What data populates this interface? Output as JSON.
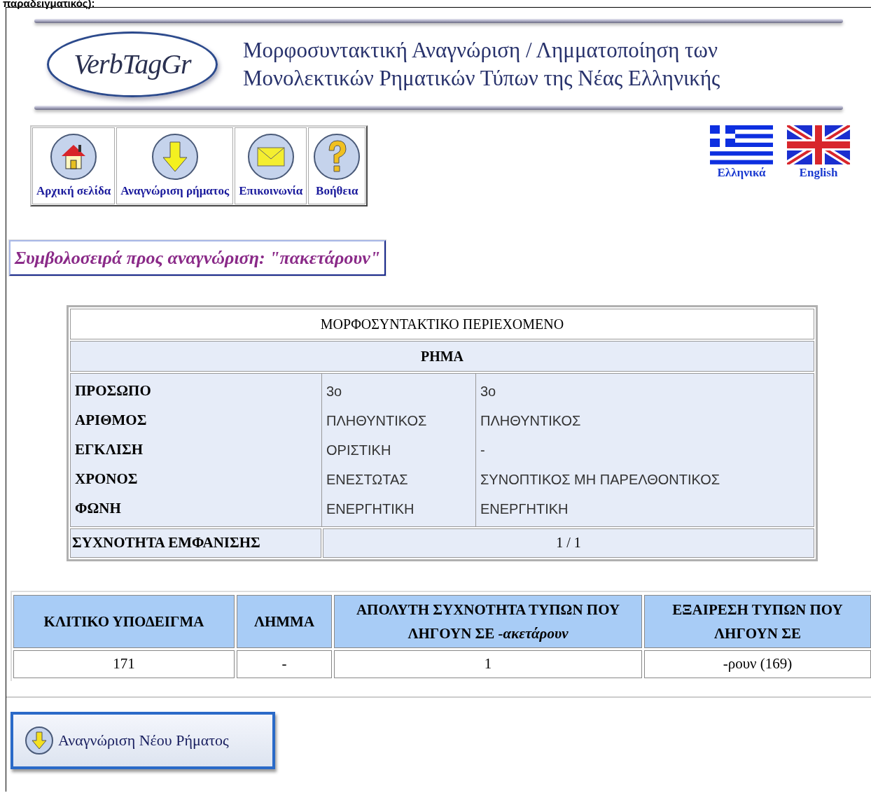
{
  "caption_above": "παραδειγματικός):",
  "header": {
    "logo": "VerbTagGr",
    "title_lines": [
      "Μορφοσυντακτική Αναγνώριση / Λημματοποίηση των",
      "Μονολεκτικών Ρηματικών Τύπων της Νέας Ελληνικής"
    ]
  },
  "nav": [
    {
      "label": "Αρχική σελίδα",
      "kind": "house"
    },
    {
      "label": "Αναγνώριση ρήματος",
      "kind": "arrow"
    },
    {
      "label": "Επικοινωνία",
      "kind": "envelope"
    },
    {
      "label": "Βοήθεια",
      "kind": "question"
    }
  ],
  "languages": [
    {
      "label": "Ελληνικά",
      "kind": "greece"
    },
    {
      "label": "English",
      "kind": "uk"
    }
  ],
  "query": "Συμβολοσειρά προς αναγνώριση: \"πακετάρουν\"",
  "analysis": {
    "title": "ΜΟΡΦΟΣΥΝΤΑΚΤΙΚΟ ΠΕΡΙΕΧΟΜΕΝΟ",
    "subtitle": "ΡΗΜΑ",
    "rows": [
      {
        "label": "ΠΡΟΣΩΠΟ",
        "values": [
          "3ο",
          "3ο"
        ]
      },
      {
        "label": "ΑΡΙΘΜΟΣ",
        "values": [
          "ΠΛΗΘΥΝΤΙΚΟΣ",
          "ΠΛΗΘΥΝΤΙΚΟΣ"
        ]
      },
      {
        "label": "ΕΓΚΛΙΣΗ",
        "values": [
          "ΟΡΙΣΤΙΚΗ",
          "-"
        ]
      },
      {
        "label": "ΧΡΟΝΟΣ",
        "values": [
          "ΕΝΕΣΤΩΤΑΣ",
          "ΣΥΝΟΠΤΙΚΟΣ ΜΗ ΠΑΡΕΛΘΟΝΤΙΚΟΣ"
        ]
      },
      {
        "label": "ΦΩΝΗ",
        "values": [
          "ΕΝΕΡΓΗΤΙΚΗ",
          "ΕΝΕΡΓΗΤΙΚΗ"
        ]
      }
    ],
    "frequency": {
      "label": "ΣΥΧΝΟΤΗΤΑ ΕΜΦΑΝΙΣΗΣ",
      "value": "1 / 1"
    }
  },
  "stats": {
    "columns": [
      "ΚΛΙΤΙΚΟ ΥΠΟΔΕΙΓΜΑ",
      "ΛΗΜΜΑ",
      "ΑΠΟΛΥΤΗ ΣΥΧΝΟΤΗΤΑ ΤΥΠΩΝ ΠΟΥ ΛΗΓΟΥΝ ΣΕ *-ακετάρουν*",
      "ΕΞΑΙΡΕΣΗ ΤΥΠΩΝ ΠΟΥ ΛΗΓΟΥΝ ΣΕ"
    ],
    "rows": [
      [
        "171",
        "-",
        "1",
        "-ρουν (169)"
      ]
    ]
  },
  "new_button": "Αναγνώριση Νέου Ρήματος"
}
